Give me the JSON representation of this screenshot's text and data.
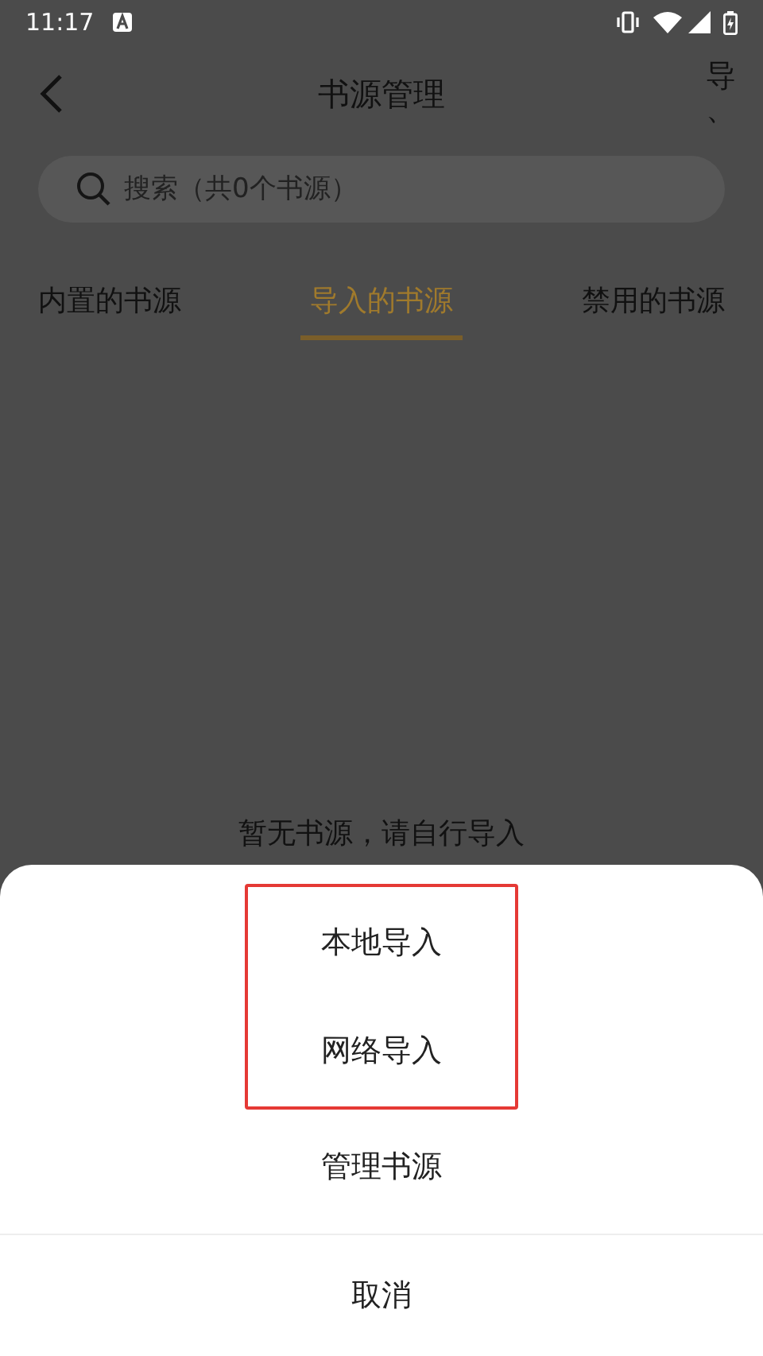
{
  "status_bar": {
    "time": "11:17"
  },
  "header": {
    "title": "书源管理",
    "action": "导、"
  },
  "search": {
    "placeholder": "搜索（共0个书源）"
  },
  "tabs": [
    {
      "label": "内置的书源",
      "selected": false
    },
    {
      "label": "导入的书源",
      "selected": true
    },
    {
      "label": "禁用的书源",
      "selected": false
    }
  ],
  "empty_message": "暂无书源，请自行导入",
  "sheet": {
    "options": [
      {
        "label": "本地导入",
        "highlighted": true
      },
      {
        "label": "网络导入",
        "highlighted": true
      },
      {
        "label": "管理书源",
        "highlighted": false
      }
    ],
    "cancel": "取消"
  }
}
